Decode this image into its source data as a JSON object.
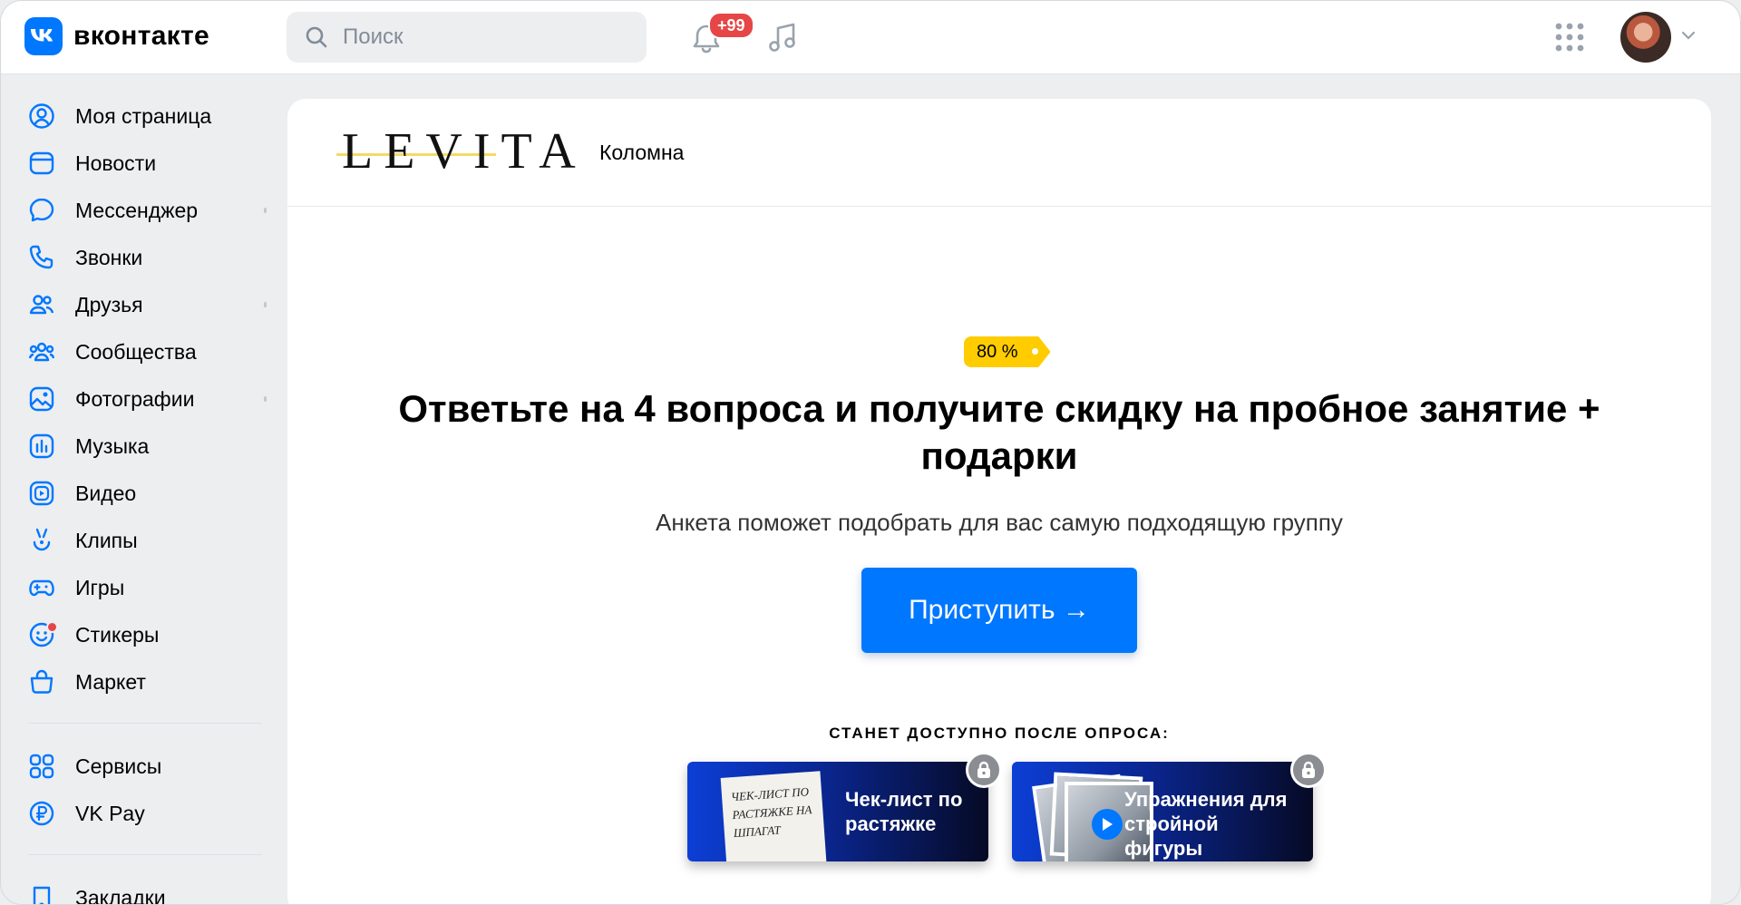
{
  "header": {
    "brand": "вконтакте",
    "search_placeholder": "Поиск",
    "notifications_badge": "+99"
  },
  "sidebar": {
    "items": [
      {
        "label": "Моя страница",
        "icon": "user-circle-icon"
      },
      {
        "label": "Новости",
        "icon": "newsfeed-icon"
      },
      {
        "label": "Мессенджер",
        "icon": "message-icon"
      },
      {
        "label": "Звонки",
        "icon": "phone-icon"
      },
      {
        "label": "Друзья",
        "icon": "friends-icon"
      },
      {
        "label": "Сообщества",
        "icon": "communities-icon"
      },
      {
        "label": "Фотографии",
        "icon": "photos-icon"
      },
      {
        "label": "Музыка",
        "icon": "music-icon"
      },
      {
        "label": "Видео",
        "icon": "video-icon"
      },
      {
        "label": "Клипы",
        "icon": "clips-icon"
      },
      {
        "label": "Игры",
        "icon": "gamepad-icon"
      },
      {
        "label": "Стикеры",
        "icon": "smile-icon"
      },
      {
        "label": "Маркет",
        "icon": "market-bag-icon"
      }
    ],
    "services": [
      {
        "label": "Сервисы",
        "icon": "services-grid-icon"
      },
      {
        "label": "VK Pay",
        "icon": "vkpay-icon"
      }
    ],
    "bookmarks": {
      "label": "Закладки",
      "icon": "bookmark-icon"
    }
  },
  "card": {
    "brand_logo": "LEVITA",
    "city": "Коломна",
    "discount_tag": "80 %",
    "headline": "Ответьте на 4 вопроса и получите скидку на пробное занятие + подарки",
    "subtitle": "Анкета поможет подобрать для вас самую подходящую группу",
    "cta_label": "Приступить →",
    "available_label": "СТАНЕТ ДОСТУПНО ПОСЛЕ ОПРОСА:",
    "bonuses": [
      {
        "title": "Чек-лист по растяжке",
        "thumb_text": "ЧЕК-ЛИСТ ПО РАСТЯЖКЕ НА ШПАГАТ"
      },
      {
        "title": "Упражнения для стройной фигуры"
      }
    ]
  },
  "colors": {
    "accent": "#0077FF",
    "badge": "#E64646",
    "tag": "#FFCC00",
    "background": "#EDEEF0"
  }
}
